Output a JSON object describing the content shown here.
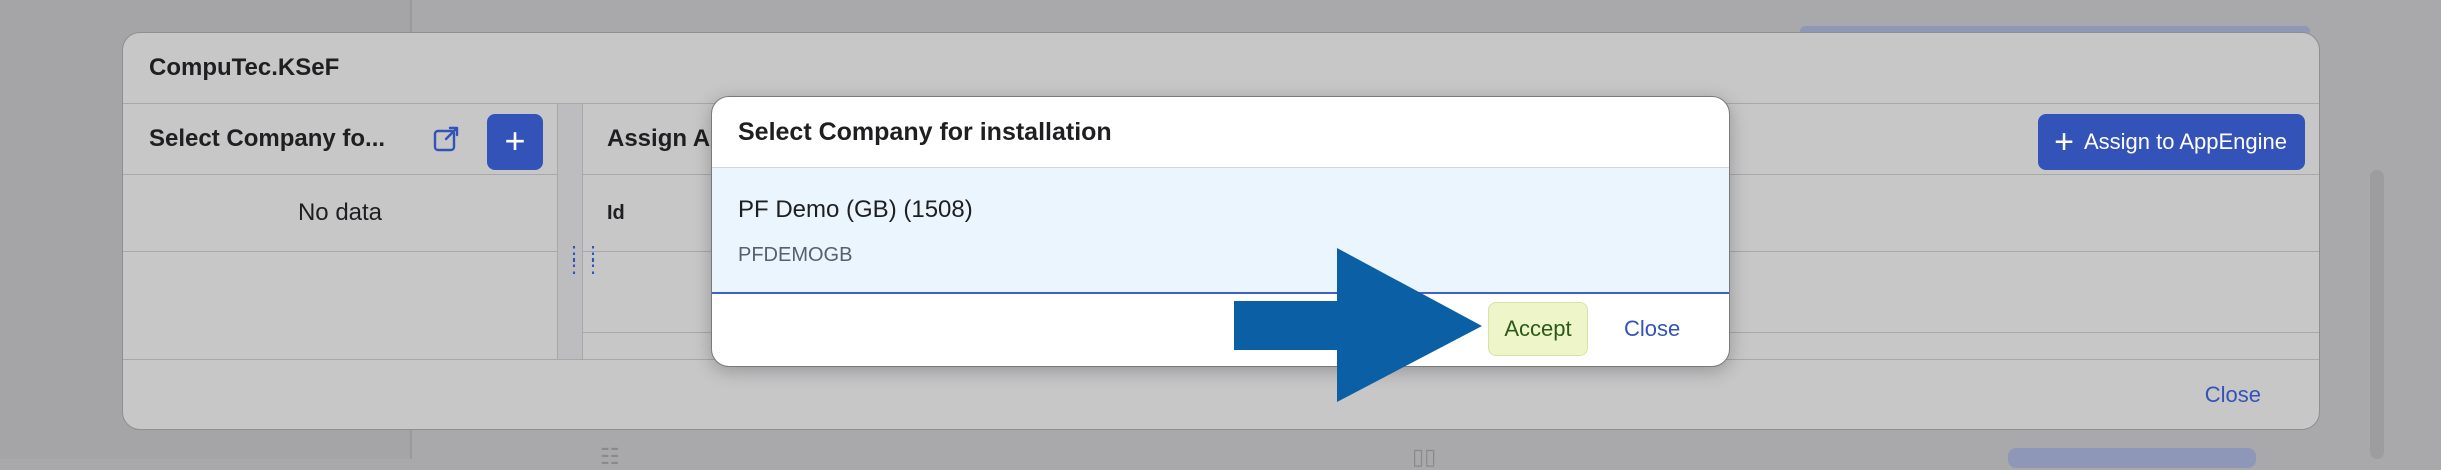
{
  "background": {
    "bottom_glyph_left": "☷",
    "bottom_glyph_right": "▯▯"
  },
  "window": {
    "title": "CompuTec.KSeF",
    "close_label": "Close"
  },
  "left_pane": {
    "title": "Select Company fo...",
    "export_icon": "export-icon",
    "add_icon": "plus-icon",
    "add_label": "+",
    "empty_text": "No data"
  },
  "right_pane": {
    "title": "Assign AppEngine",
    "assign_button_label": "Assign to AppEngine",
    "assign_plus": "+",
    "columns": [
      "Id"
    ]
  },
  "dialog": {
    "title": "Select Company for installation",
    "items": [
      {
        "name": "PF Demo (GB) (1508)",
        "code": "PFDEMOGB"
      }
    ],
    "accept_label": "Accept",
    "close_label": "Close"
  },
  "colors": {
    "accent": "#3453b8",
    "arrow": "#0b5fa5",
    "accept_bg": "#eef5c8",
    "selected_row": "#ebf5fe"
  }
}
